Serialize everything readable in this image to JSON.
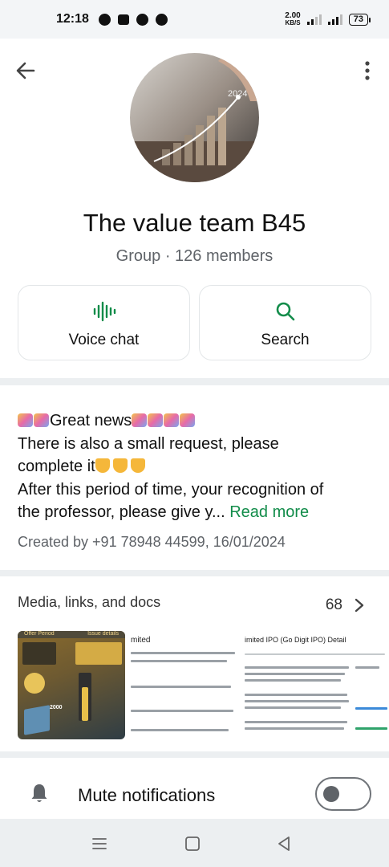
{
  "status_bar": {
    "time": "12:18",
    "net_speed_value": "2.00",
    "net_speed_unit": "KB/S",
    "battery": "73"
  },
  "group": {
    "title": "The value team B45",
    "subtitle": "Group · 126 members",
    "avatar_text": "2024"
  },
  "actions": {
    "voice_chat_label": "Voice chat",
    "search_label": "Search"
  },
  "description": {
    "line1": "Great news",
    "line2": "There is also a small request, please",
    "line3": "complete it",
    "line4": "After this period of time, your recognition of",
    "line5": "the professor, please give y...",
    "read_more": "Read more",
    "created": "Created by +91 78948 44599, 16/01/2024"
  },
  "media": {
    "title": "Media, links, and docs",
    "count": "68",
    "thumb1_head_left": "Offer Period",
    "thumb1_head_right": "Issue details",
    "thumb2_title": "mited",
    "thumb3_title": "imited IPO (Go Digit IPO) Detail",
    "thumb1_bid": "2000"
  },
  "mute": {
    "label": "Mute notifications",
    "enabled": false
  },
  "colors": {
    "accent_green": "#128c4a",
    "background": "#eceff1"
  }
}
